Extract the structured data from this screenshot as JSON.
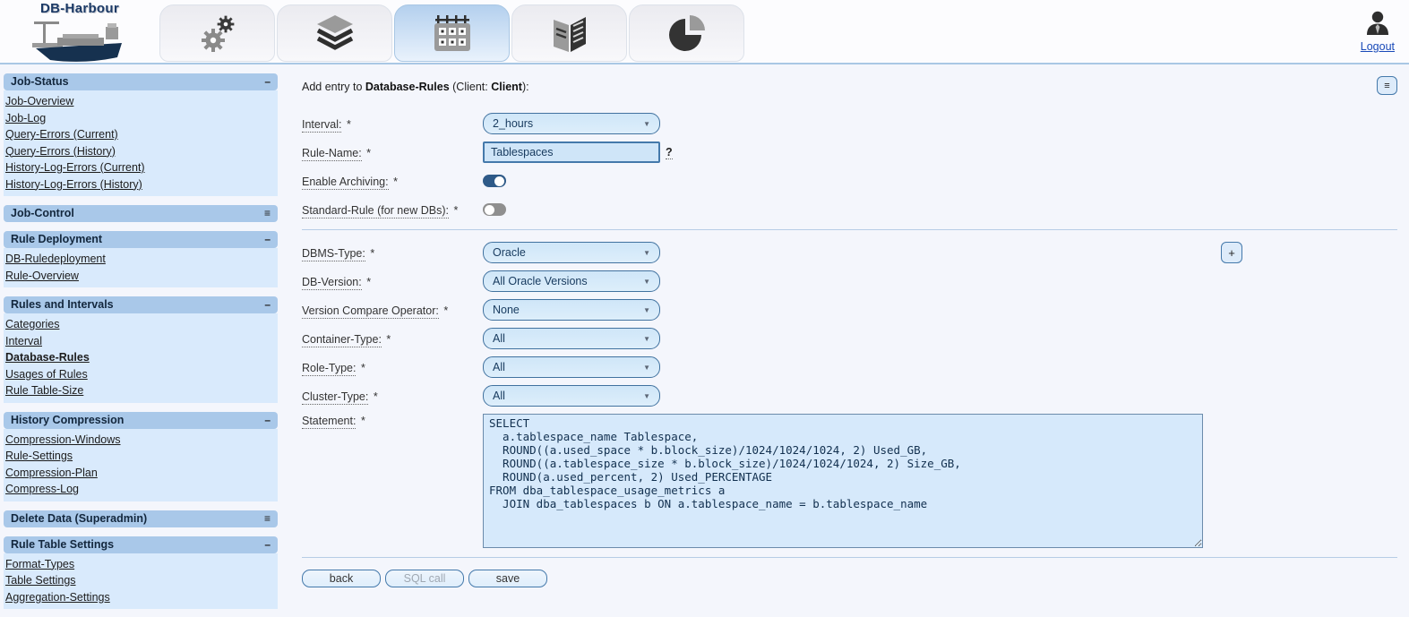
{
  "header": {
    "logo_text": "DB-Harbour",
    "logout_label": "Logout",
    "tabs": [
      {
        "icon": "gears-icon",
        "active": false
      },
      {
        "icon": "layers-icon",
        "active": false
      },
      {
        "icon": "calendar-icon",
        "active": true
      },
      {
        "icon": "book-icon",
        "active": false
      },
      {
        "icon": "pie-chart-icon",
        "active": false
      }
    ]
  },
  "sidebar": {
    "sections": [
      {
        "title": "Job-Status",
        "toggle_glyph": "–",
        "collapsed": false,
        "items": [
          "Job-Overview",
          "Job-Log",
          "Query-Errors (Current)",
          "Query-Errors (History)",
          "History-Log-Errors (Current)",
          "History-Log-Errors (History)"
        ]
      },
      {
        "title": "Job-Control",
        "toggle_glyph": "≡",
        "collapsed": true,
        "items": []
      },
      {
        "title": "Rule Deployment",
        "toggle_glyph": "–",
        "collapsed": false,
        "items": [
          "DB-Ruledeployment",
          "Rule-Overview"
        ]
      },
      {
        "title": "Rules and Intervals",
        "toggle_glyph": "–",
        "collapsed": false,
        "items": [
          "Categories",
          "Interval",
          "Database-Rules",
          "Usages of Rules",
          "Rule Table-Size"
        ],
        "active_item": "Database-Rules"
      },
      {
        "title": "History Compression",
        "toggle_glyph": "–",
        "collapsed": false,
        "items": [
          "Compression-Windows",
          "Rule-Settings",
          "Compression-Plan",
          "Compress-Log"
        ]
      },
      {
        "title": "Delete Data (Superadmin)",
        "toggle_glyph": "≡",
        "collapsed": true,
        "items": []
      },
      {
        "title": "Rule Table Settings",
        "toggle_glyph": "–",
        "collapsed": false,
        "items": [
          "Format-Types",
          "Table Settings",
          "Aggregation-Settings"
        ]
      }
    ]
  },
  "form": {
    "heading": {
      "prefix": "Add entry to ",
      "entity": "Database-Rules",
      "mid": " (Client: ",
      "client": "Client",
      "suffix": "):"
    },
    "required_marker": "*",
    "fields": {
      "interval": {
        "label": "Interval:",
        "value": "2_hours"
      },
      "rule_name": {
        "label": "Rule-Name:",
        "value": "Tablespaces",
        "help": "?"
      },
      "enable_archiving": {
        "label": "Enable Archiving:",
        "state": "on"
      },
      "standard_rule": {
        "label": "Standard-Rule (for new DBs):",
        "state": "off"
      },
      "dbms_type": {
        "label": "DBMS-Type:",
        "value": "Oracle"
      },
      "db_version": {
        "label": "DB-Version:",
        "value": "All Oracle Versions"
      },
      "version_compare": {
        "label": "Version Compare Operator:",
        "value": "None"
      },
      "container_type": {
        "label": "Container-Type:",
        "value": "All"
      },
      "role_type": {
        "label": "Role-Type:",
        "value": "All"
      },
      "cluster_type": {
        "label": "Cluster-Type:",
        "value": "All"
      },
      "statement": {
        "label": "Statement:",
        "value": "SELECT\n  a.tablespace_name Tablespace,\n  ROUND((a.used_space * b.block_size)/1024/1024/1024, 2) Used_GB,\n  ROUND((a.tablespace_size * b.block_size)/1024/1024/1024, 2) Size_GB,\n  ROUND(a.used_percent, 2) Used_PERCENTAGE\nFROM dba_tablespace_usage_metrics a\n  JOIN dba_tablespaces b ON a.tablespace_name = b.tablespace_name"
      }
    },
    "buttons": {
      "back": "back",
      "sql_call": "SQL call",
      "save": "save"
    }
  },
  "icons": {
    "dropdown_arrow": "▼",
    "menu": "≡",
    "plus": "+"
  },
  "colors": {
    "accent_blue": "#2e5a88",
    "panel_header": "#a9c8e9",
    "panel_body": "#d9eafc",
    "control_fill": "#cfe6f8",
    "control_border": "#4479ab",
    "toggle_off": "#8f8f8f",
    "link_blue": "#1849b8"
  }
}
